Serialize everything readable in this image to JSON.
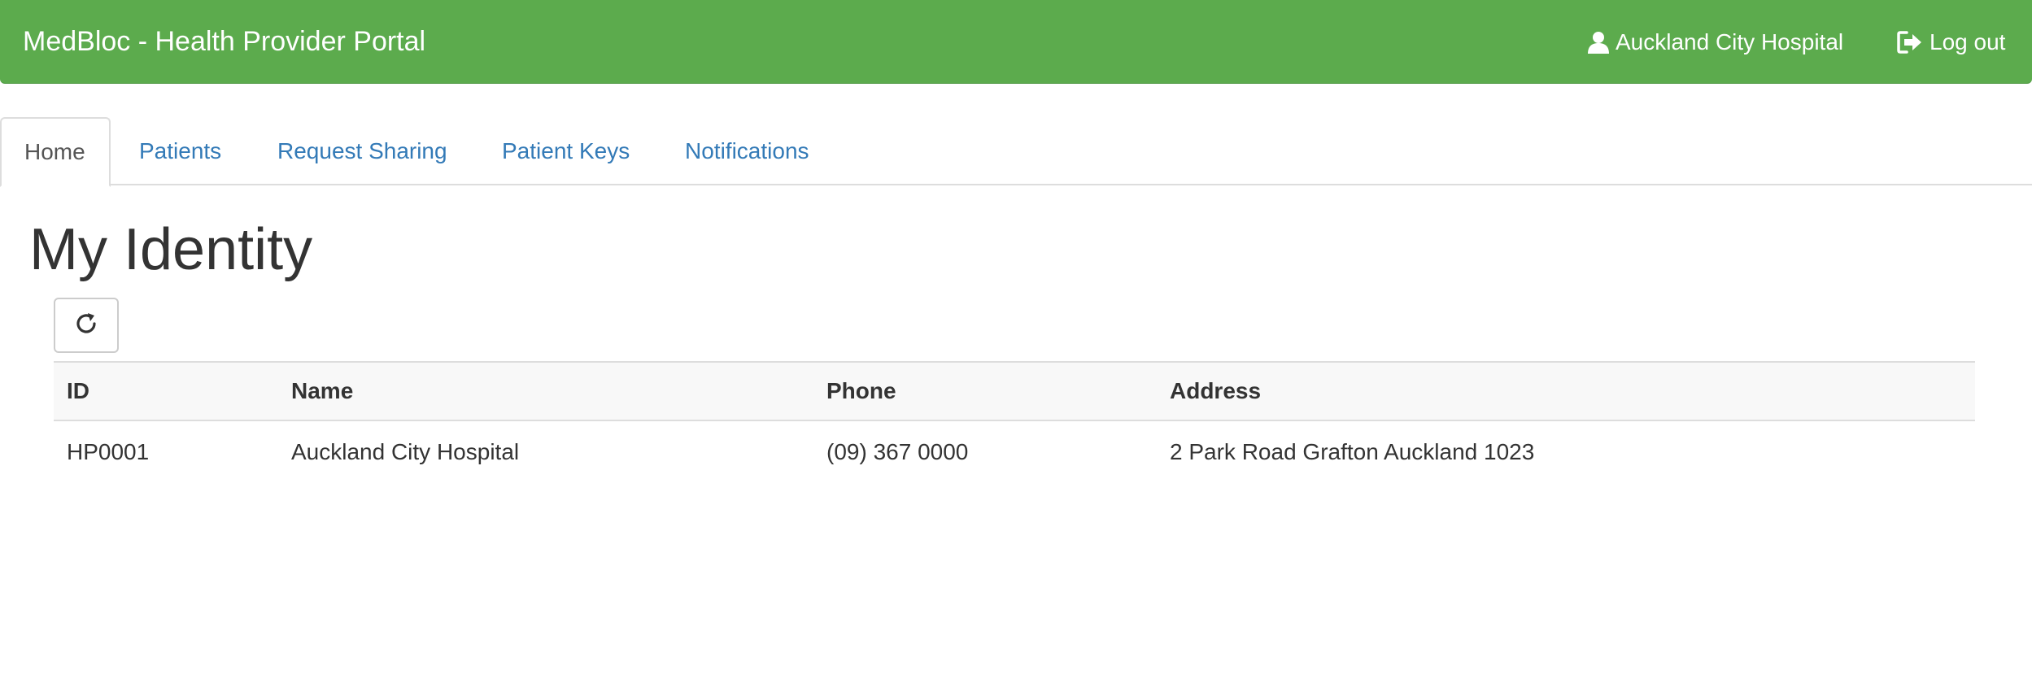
{
  "navbar": {
    "brand": "MedBloc - Health Provider Portal",
    "user_label": "Auckland City Hospital",
    "user_icon": "user-icon",
    "logout_label": "Log out",
    "logout_icon": "log-out-icon",
    "bg_color": "#5cab4d"
  },
  "tabs": [
    {
      "label": "Home",
      "active": true
    },
    {
      "label": "Patients",
      "active": false
    },
    {
      "label": "Request Sharing",
      "active": false
    },
    {
      "label": "Patient Keys",
      "active": false
    },
    {
      "label": "Notifications",
      "active": false
    }
  ],
  "main": {
    "title": "My Identity",
    "refresh_icon": "refresh-icon"
  },
  "table": {
    "headers": [
      "ID",
      "Name",
      "Phone",
      "Address"
    ],
    "rows": [
      [
        "HP0001",
        "Auckland City Hospital",
        "(09) 367 0000",
        "2 Park Road Grafton Auckland 1023"
      ]
    ]
  },
  "colors": {
    "link": "#337ab7",
    "header_bg": "#f8f8f8"
  }
}
